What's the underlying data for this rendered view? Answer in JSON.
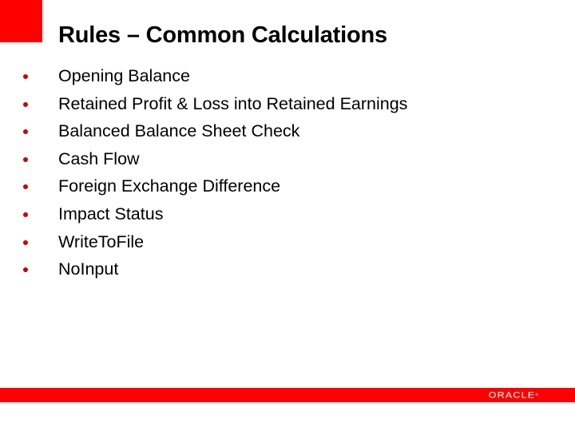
{
  "slide": {
    "title": "Rules – Common Calculations",
    "bullets": [
      "Opening Balance",
      "Retained Profit & Loss into Retained Earnings",
      "Balanced Balance Sheet Check",
      "Cash Flow",
      "Foreign Exchange Difference",
      "Impact Status",
      "WriteToFile",
      "NoInput"
    ]
  },
  "footer": {
    "logo_text": "ORACLE",
    "logo_mark": "®"
  },
  "colors": {
    "accent": "#ff0000",
    "bullet": "#cc0000",
    "text": "#000000"
  }
}
